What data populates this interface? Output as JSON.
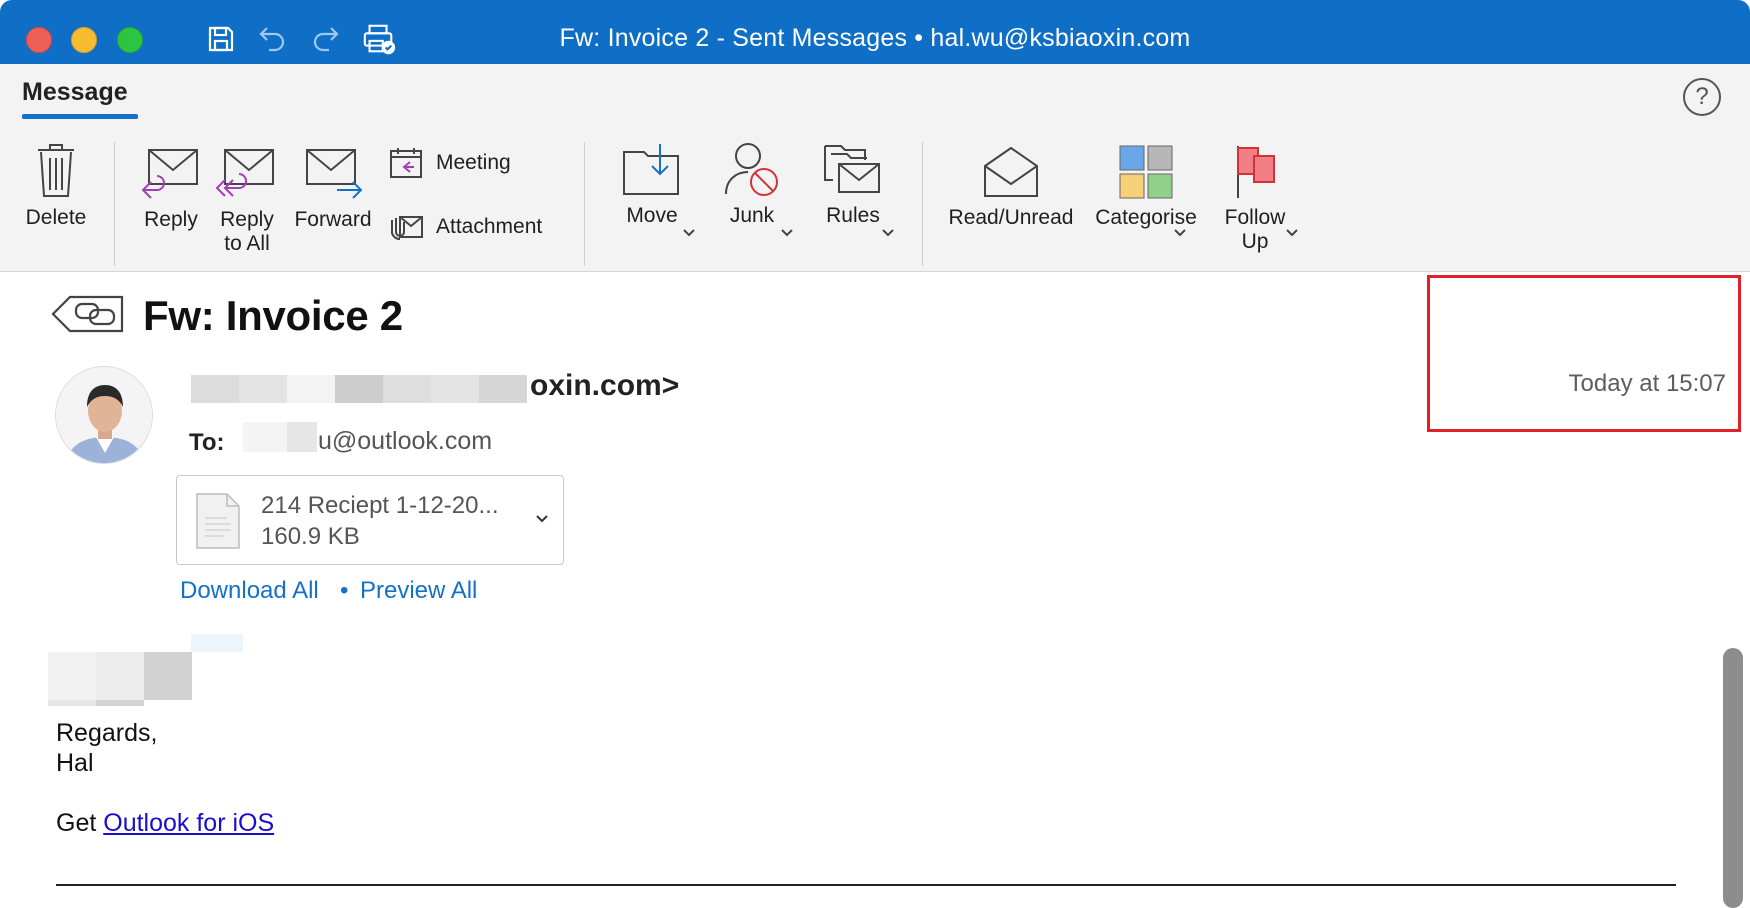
{
  "window": {
    "title": "Fw: Invoice 2 - Sent Messages • hal.wu@ksbiaoxin.com"
  },
  "ribbon": {
    "active_tab": "Message",
    "help_glyph": "?",
    "buttons": {
      "delete": "Delete",
      "reply": "Reply",
      "reply_all_line1": "Reply",
      "reply_all_line2": "to All",
      "forward": "Forward",
      "meeting": "Meeting",
      "attachment": "Attachment",
      "move": "Move",
      "junk": "Junk",
      "rules": "Rules",
      "read_unread": "Read/Unread",
      "categorise": "Categorise",
      "follow_up_line1": "Follow",
      "follow_up_line2": "Up"
    }
  },
  "message": {
    "subject": "Fw: Invoice 2",
    "timestamp": "Today at 15:07",
    "sender_visible": "oxin.com>",
    "to_label": "To:",
    "to_visible": "u@outlook.com",
    "attachment": {
      "name": "214 Reciept 1-12-20...",
      "size": "160.9 KB"
    },
    "links": {
      "download_all": "Download All",
      "separator": "•",
      "preview_all": "Preview All"
    },
    "body": {
      "regards": "Regards,",
      "name": "Hal",
      "get": "Get",
      "outlook_link": "Outlook for iOS"
    }
  },
  "colors": {
    "titlebar": "#0f6fc6",
    "accent": "#1570c9",
    "highlight_box": "#e0212a"
  }
}
